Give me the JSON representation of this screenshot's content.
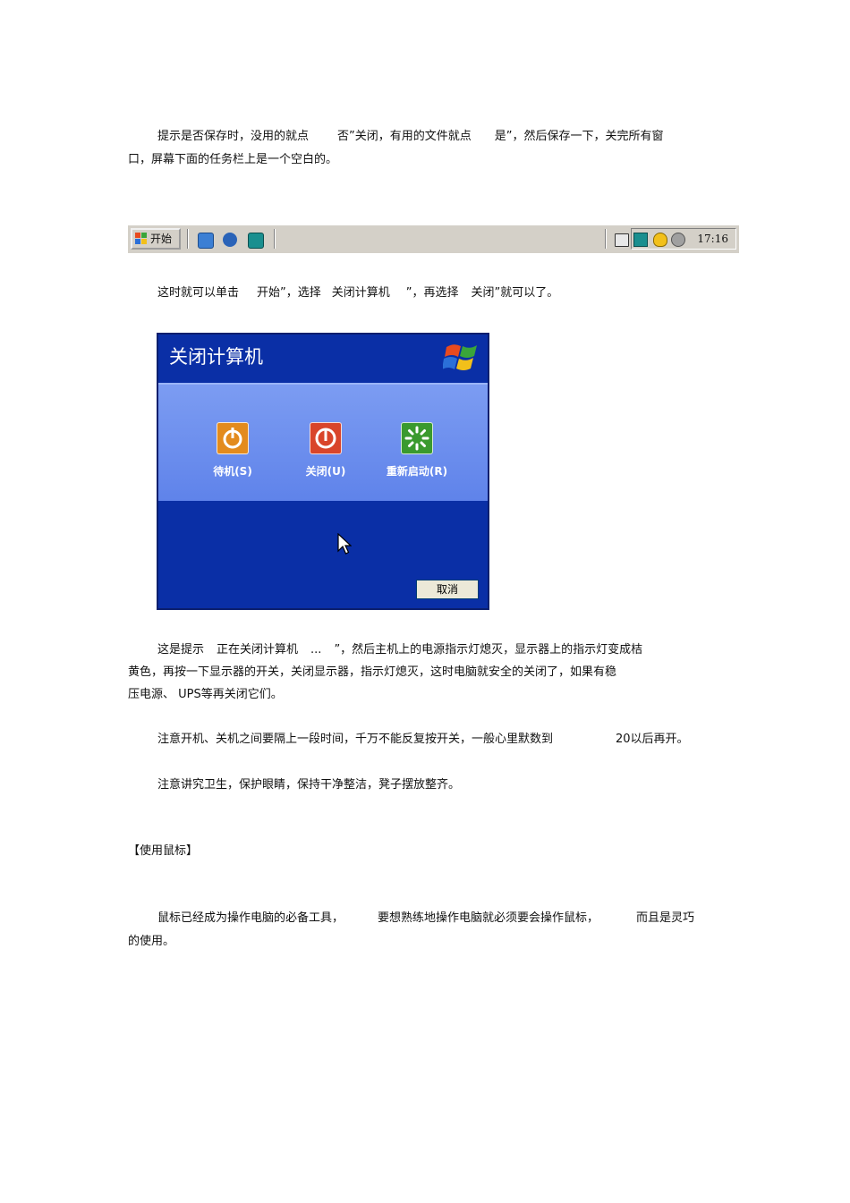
{
  "paragraphs": {
    "p1_line1_a": "提示是否保存时，没用的就点",
    "p1_line1_b": "否”关闭，有用的文件就点",
    "p1_line1_c": "是”，然后保存一下，关完所有窗",
    "p1_line2": "口，屏幕下面的任务栏上是一个空白的。",
    "p2_a": "这时就可以单击",
    "p2_b": "开始”，选择",
    "p2_c": "关闭计算机",
    "p2_d": "”，再选择",
    "p2_e": "关闭”就可以了。",
    "p3_line1_a": "这是提示",
    "p3_line1_b": "正在关闭计算机",
    "p3_line1_c": "...",
    "p3_line1_d": "”，然后主机上的电源指示灯熄灭，显示器上的指示灯变成桔",
    "p3_line2": "黄色，再按一下显示器的开关，关闭显示器，指示灯熄灭，这时电脑就安全的关闭了，如果有稳",
    "p3_line3": "压电源、 UPS等再关闭它们。",
    "p4_a": "注意开机、关机之间要隔上一段时间，千万不能反复按开关，一般心里默数到",
    "p4_b": "20以后再开。",
    "p5": "注意讲究卫生，保护眼睛，保持干净整洁，凳子摆放整齐。",
    "heading": "【使用鼠标】",
    "p6_line1_a": "鼠标已经成为操作电脑的必备工具，",
    "p6_line1_b": "要想熟练地操作电脑就必须要会操作鼠标，",
    "p6_line1_c": "而且是灵巧",
    "p6_line2": "的使用。"
  },
  "taskbar": {
    "start_label": "开始",
    "clock": "17:16",
    "quick_launch_icons": [
      "ie-icon",
      "media-icon",
      "network-icon"
    ],
    "tray_icons": [
      "keyboard-icon",
      "network-icon",
      "shield-icon",
      "security-icon"
    ]
  },
  "dialog": {
    "title": "关闭计算机",
    "options": [
      {
        "label": "待机(S)",
        "icon": "standby-icon",
        "color": "#e38b1e"
      },
      {
        "label": "关闭(U)",
        "icon": "power-off-icon",
        "color": "#d9452b"
      },
      {
        "label": "重新启动(R)",
        "icon": "restart-icon",
        "color": "#3a9a2e"
      }
    ],
    "cancel_label": "取消"
  }
}
